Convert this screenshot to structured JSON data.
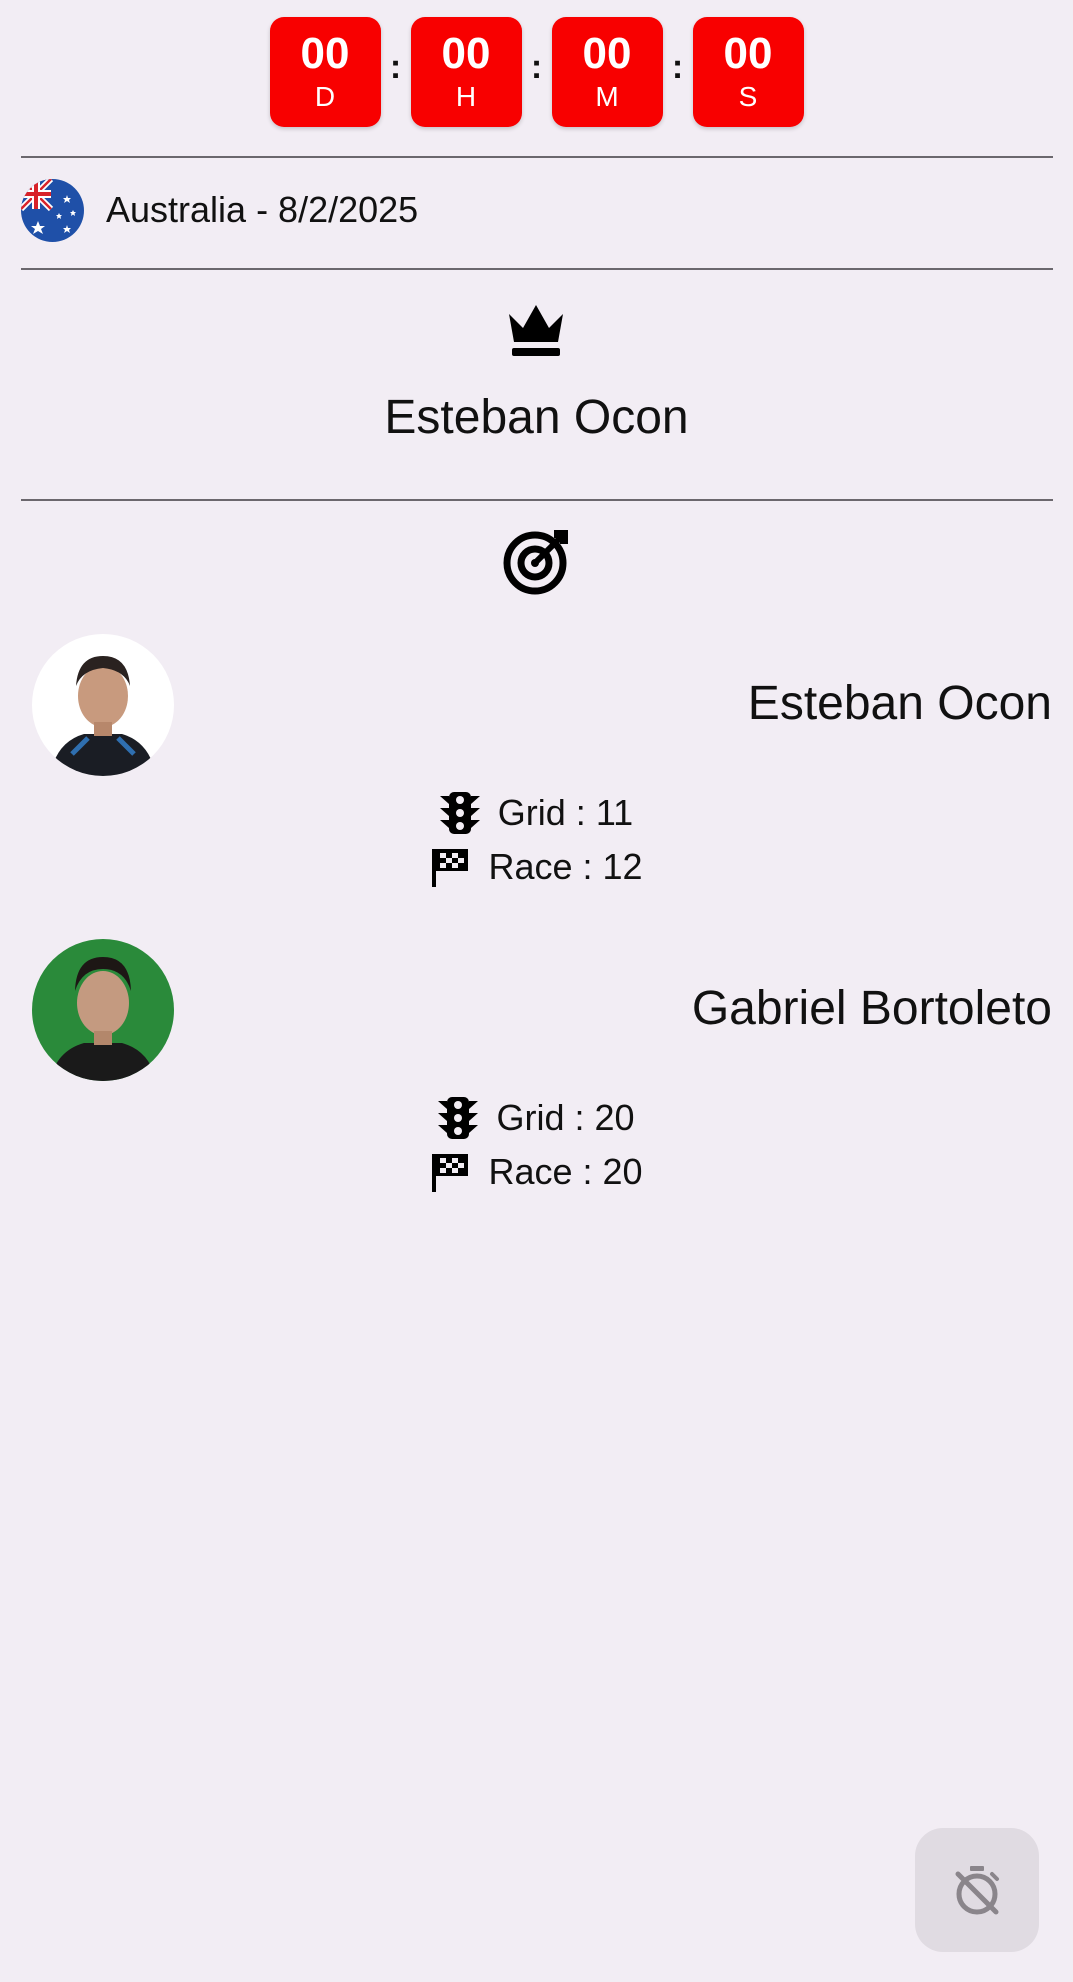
{
  "countdown": {
    "days": {
      "value": "00",
      "unit": "D"
    },
    "hours": {
      "value": "00",
      "unit": "H"
    },
    "minutes": {
      "value": "00",
      "unit": "M"
    },
    "seconds": {
      "value": "00",
      "unit": "S"
    },
    "separator": ":",
    "accent_color": "#f80000"
  },
  "race": {
    "flag_icon": "australia-flag-icon",
    "title": "Australia - 8/2/2025"
  },
  "winner": {
    "icon": "crown-icon",
    "name": "Esteban Ocon"
  },
  "prediction_icon": "target-icon",
  "drivers": [
    {
      "name": "Esteban Ocon",
      "grid_label": "Grid : 11",
      "race_label": "Race : 12"
    },
    {
      "name": "Gabriel Bortoleto",
      "grid_label": "Grid : 20",
      "race_label": "Race : 20"
    }
  ],
  "fab": {
    "icon": "timer-off-icon"
  }
}
